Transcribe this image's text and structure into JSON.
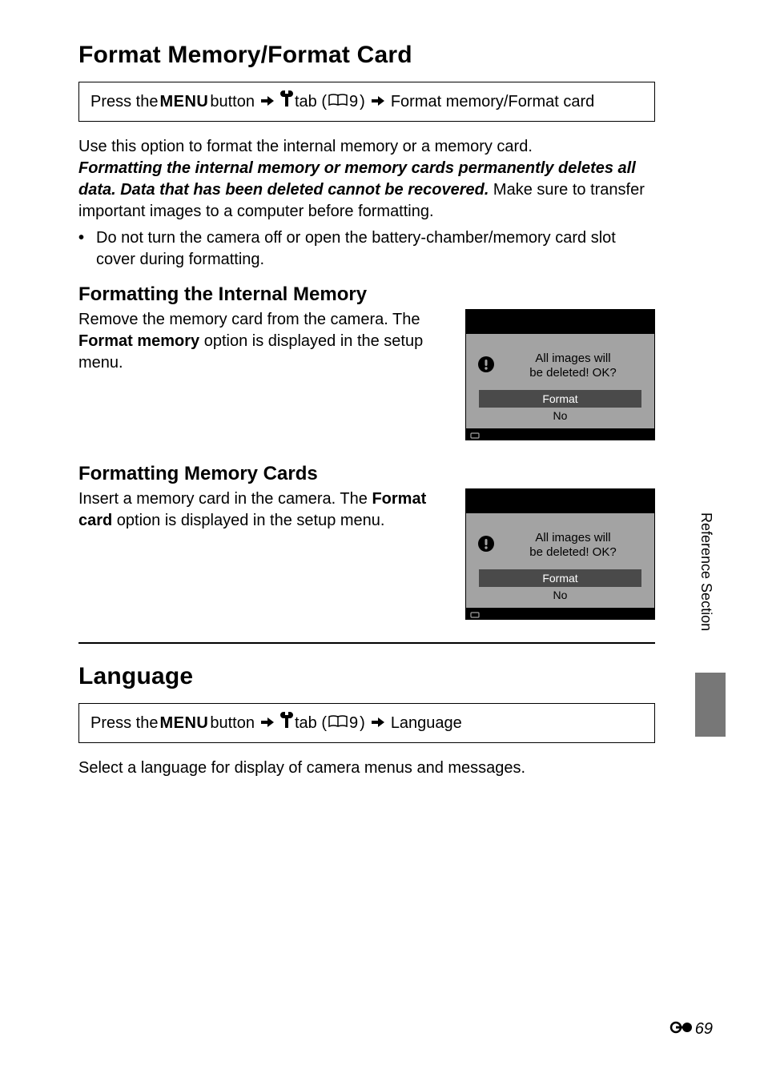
{
  "section1": {
    "heading": "Format Memory/Format Card",
    "nav": {
      "press_the": "Press the ",
      "menu_label": "MENU",
      "button_word": " button ",
      "tab_word": " tab (",
      "page_ref": "9",
      "close_paren": ") ",
      "dest": " Format memory/Format card"
    },
    "intro_line1": "Use this option to format the internal memory or a memory card.",
    "warn_bold": "Formatting the internal memory or memory cards permanently deletes all data. Data that has been deleted cannot be recovered.",
    "warn_tail": " Make sure to transfer important images to a computer before formatting.",
    "bullet1": "Do not turn the camera off or open the battery-chamber/memory card slot cover during formatting.",
    "sub1": {
      "heading": "Formatting the Internal Memory",
      "text_pre": "Remove the memory card from the camera. The ",
      "text_bold": "Format memory",
      "text_post": " option is displayed in the setup menu."
    },
    "sub2": {
      "heading": "Formatting Memory Cards",
      "text_pre": "Insert a memory card in the camera. The ",
      "text_bold": "Format card",
      "text_post": " option is displayed in the setup menu."
    },
    "screen": {
      "msg_l1": "All images will",
      "msg_l2": "be deleted! OK?",
      "opt_format": "Format",
      "opt_no": "No"
    }
  },
  "section2": {
    "heading": "Language",
    "nav": {
      "press_the": "Press the ",
      "menu_label": "MENU",
      "button_word": " button ",
      "tab_word": " tab (",
      "page_ref": "9",
      "close_paren": ") ",
      "dest": " Language"
    },
    "body": "Select a language for display of camera menus and messages."
  },
  "side_label": "Reference Section",
  "page_number": "69"
}
